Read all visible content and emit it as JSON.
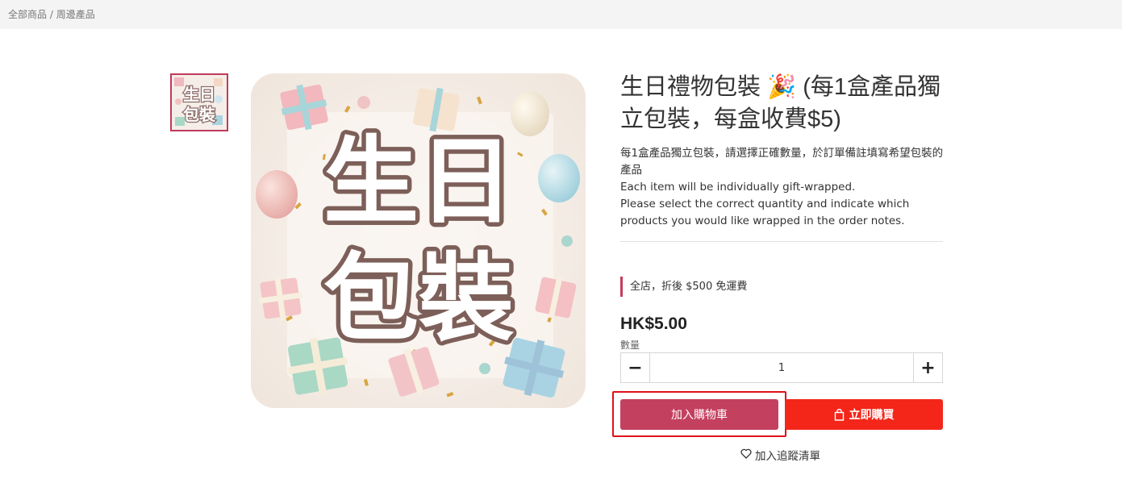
{
  "breadcrumb": {
    "all_products": "全部商品",
    "separator": "/",
    "category": "周邊產品"
  },
  "product": {
    "title": "生日禮物包裝 🎉 (每1盒產品獨立包裝，每盒收費$5)",
    "image_text_line1": "生日",
    "image_text_line2": "包裝",
    "description": [
      "每1盒產品獨立包裝，請選擇正確數量，於訂單備註填寫希望包裝的產品",
      "Each item will be individually gift-wrapped.",
      "Please select the correct quantity and indicate which products you would like wrapped in the order notes."
    ],
    "promo": "全店，折後 $500 免運費",
    "price": "HK$5.00",
    "quantity_label": "數量",
    "quantity": "1"
  },
  "buttons": {
    "minus": "−",
    "plus": "+",
    "add_to_cart": "加入購物車",
    "buy_now": "立即購買",
    "wishlist": "加入追蹤清單"
  },
  "colors": {
    "accent": "#c4405f",
    "buy": "#f4261a",
    "highlight": "#e0101a"
  },
  "icons": {
    "bag": "shopping-bag-icon",
    "heart": "heart-icon"
  }
}
